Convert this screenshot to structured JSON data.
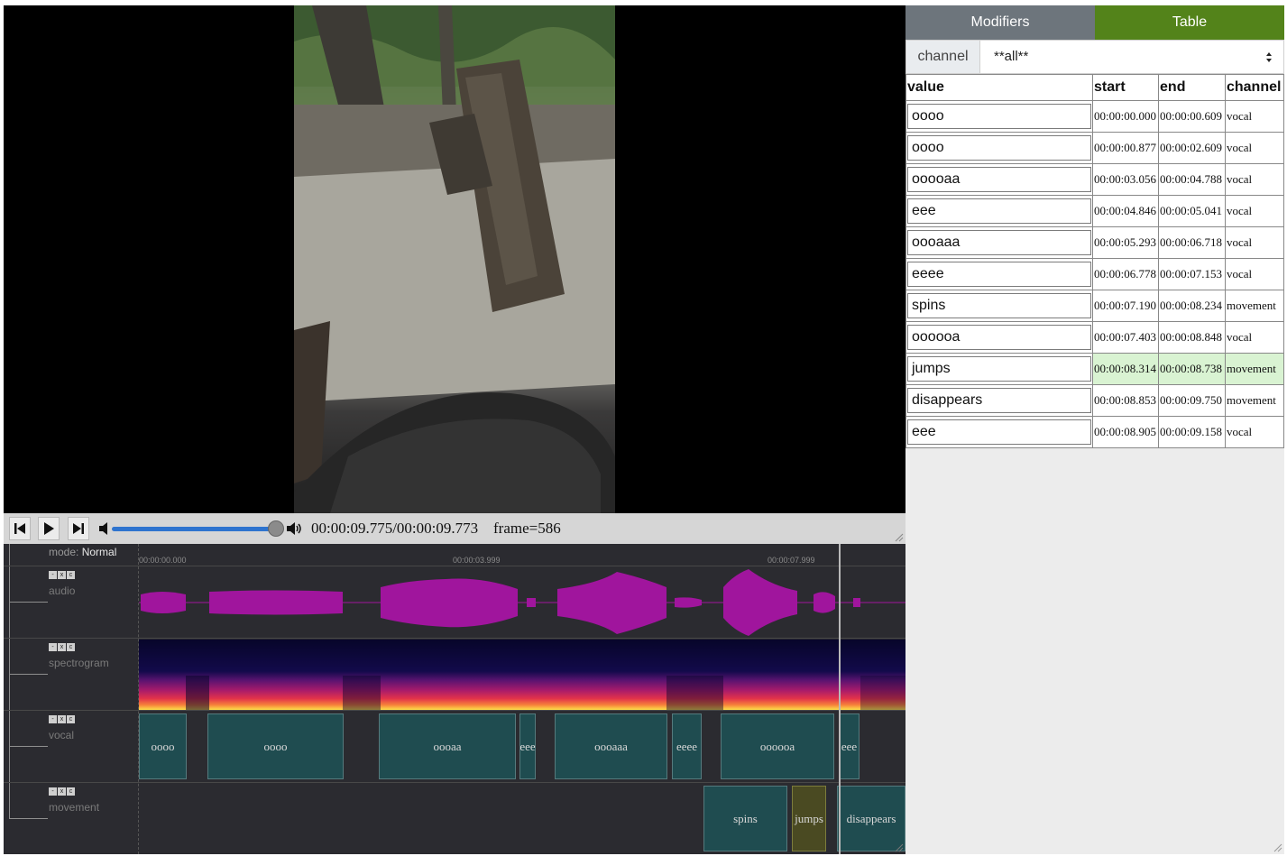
{
  "player": {
    "time": "00:00:09.775/00:00:09.773",
    "frame": "frame=586",
    "volume": 1.0
  },
  "timeline": {
    "mode_label": "mode:",
    "mode_value": "Normal",
    "ticks": [
      "00:00:00.000",
      "00:00:03.999",
      "00:00:07.999"
    ],
    "track_controls": [
      "-",
      "x",
      "c"
    ],
    "tracks": [
      "audio",
      "spectrogram",
      "vocal",
      "movement"
    ],
    "vocal_segments": [
      "oooo",
      "oooo",
      "oooaa",
      "eee",
      "oooaaa",
      "eeee",
      "oooooa",
      "eee"
    ],
    "movement_segments": [
      "spins",
      "jumps",
      "disappears"
    ]
  },
  "panel": {
    "tabs": [
      "Modifiers",
      "Table"
    ],
    "filter_label": "channel",
    "filter_value": "**all**",
    "columns": [
      "value",
      "start",
      "end",
      "channel"
    ],
    "rows": [
      {
        "value": "oooo",
        "start": "00:00:00.000",
        "end": "00:00:00.609",
        "channel": "vocal"
      },
      {
        "value": "oooo",
        "start": "00:00:00.877",
        "end": "00:00:02.609",
        "channel": "vocal"
      },
      {
        "value": "ooooaa",
        "start": "00:00:03.056",
        "end": "00:00:04.788",
        "channel": "vocal"
      },
      {
        "value": "eee",
        "start": "00:00:04.846",
        "end": "00:00:05.041",
        "channel": "vocal"
      },
      {
        "value": "oooaaa",
        "start": "00:00:05.293",
        "end": "00:00:06.718",
        "channel": "vocal"
      },
      {
        "value": "eeee",
        "start": "00:00:06.778",
        "end": "00:00:07.153",
        "channel": "vocal"
      },
      {
        "value": "spins",
        "start": "00:00:07.190",
        "end": "00:00:08.234",
        "channel": "movement"
      },
      {
        "value": "oooooa",
        "start": "00:00:07.403",
        "end": "00:00:08.848",
        "channel": "vocal"
      },
      {
        "value": "jumps",
        "start": "00:00:08.314",
        "end": "00:00:08.738",
        "channel": "movement"
      },
      {
        "value": "disappears",
        "start": "00:00:08.853",
        "end": "00:00:09.750",
        "channel": "movement"
      },
      {
        "value": "eee",
        "start": "00:00:08.905",
        "end": "00:00:09.158",
        "channel": "vocal"
      }
    ]
  },
  "colors": {
    "tab_active": "#53831a",
    "tab_inactive": "#6d757c",
    "waveform": "#a0159d",
    "segment": "#1f4c50",
    "segment_active": "#4a4a22",
    "row_highlight": "#d9f3d2"
  }
}
